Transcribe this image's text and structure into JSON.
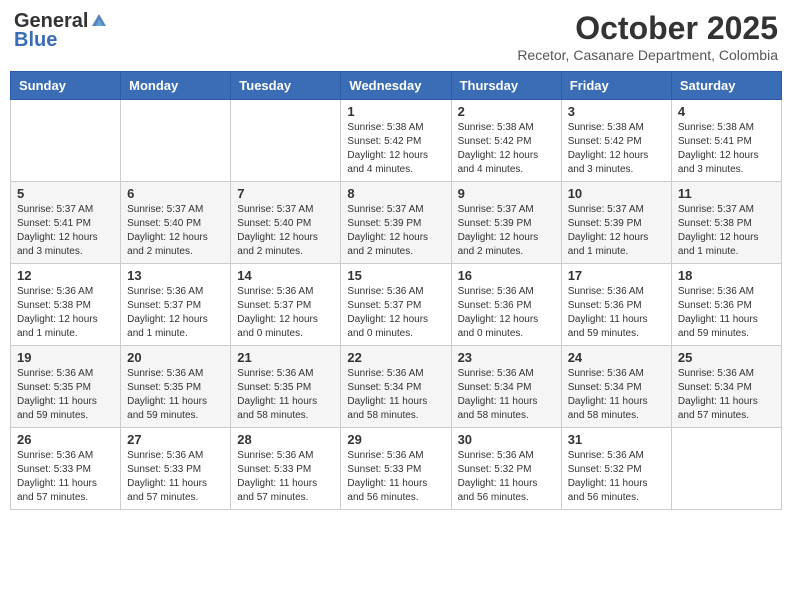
{
  "header": {
    "logo_general": "General",
    "logo_blue": "Blue",
    "month": "October 2025",
    "location": "Recetor, Casanare Department, Colombia"
  },
  "weekdays": [
    "Sunday",
    "Monday",
    "Tuesday",
    "Wednesday",
    "Thursday",
    "Friday",
    "Saturday"
  ],
  "weeks": [
    [
      {
        "day": "",
        "info": ""
      },
      {
        "day": "",
        "info": ""
      },
      {
        "day": "",
        "info": ""
      },
      {
        "day": "1",
        "info": "Sunrise: 5:38 AM\nSunset: 5:42 PM\nDaylight: 12 hours\nand 4 minutes."
      },
      {
        "day": "2",
        "info": "Sunrise: 5:38 AM\nSunset: 5:42 PM\nDaylight: 12 hours\nand 4 minutes."
      },
      {
        "day": "3",
        "info": "Sunrise: 5:38 AM\nSunset: 5:42 PM\nDaylight: 12 hours\nand 3 minutes."
      },
      {
        "day": "4",
        "info": "Sunrise: 5:38 AM\nSunset: 5:41 PM\nDaylight: 12 hours\nand 3 minutes."
      }
    ],
    [
      {
        "day": "5",
        "info": "Sunrise: 5:37 AM\nSunset: 5:41 PM\nDaylight: 12 hours\nand 3 minutes."
      },
      {
        "day": "6",
        "info": "Sunrise: 5:37 AM\nSunset: 5:40 PM\nDaylight: 12 hours\nand 2 minutes."
      },
      {
        "day": "7",
        "info": "Sunrise: 5:37 AM\nSunset: 5:40 PM\nDaylight: 12 hours\nand 2 minutes."
      },
      {
        "day": "8",
        "info": "Sunrise: 5:37 AM\nSunset: 5:39 PM\nDaylight: 12 hours\nand 2 minutes."
      },
      {
        "day": "9",
        "info": "Sunrise: 5:37 AM\nSunset: 5:39 PM\nDaylight: 12 hours\nand 2 minutes."
      },
      {
        "day": "10",
        "info": "Sunrise: 5:37 AM\nSunset: 5:39 PM\nDaylight: 12 hours\nand 1 minute."
      },
      {
        "day": "11",
        "info": "Sunrise: 5:37 AM\nSunset: 5:38 PM\nDaylight: 12 hours\nand 1 minute."
      }
    ],
    [
      {
        "day": "12",
        "info": "Sunrise: 5:36 AM\nSunset: 5:38 PM\nDaylight: 12 hours\nand 1 minute."
      },
      {
        "day": "13",
        "info": "Sunrise: 5:36 AM\nSunset: 5:37 PM\nDaylight: 12 hours\nand 1 minute."
      },
      {
        "day": "14",
        "info": "Sunrise: 5:36 AM\nSunset: 5:37 PM\nDaylight: 12 hours\nand 0 minutes."
      },
      {
        "day": "15",
        "info": "Sunrise: 5:36 AM\nSunset: 5:37 PM\nDaylight: 12 hours\nand 0 minutes."
      },
      {
        "day": "16",
        "info": "Sunrise: 5:36 AM\nSunset: 5:36 PM\nDaylight: 12 hours\nand 0 minutes."
      },
      {
        "day": "17",
        "info": "Sunrise: 5:36 AM\nSunset: 5:36 PM\nDaylight: 11 hours\nand 59 minutes."
      },
      {
        "day": "18",
        "info": "Sunrise: 5:36 AM\nSunset: 5:36 PM\nDaylight: 11 hours\nand 59 minutes."
      }
    ],
    [
      {
        "day": "19",
        "info": "Sunrise: 5:36 AM\nSunset: 5:35 PM\nDaylight: 11 hours\nand 59 minutes."
      },
      {
        "day": "20",
        "info": "Sunrise: 5:36 AM\nSunset: 5:35 PM\nDaylight: 11 hours\nand 59 minutes."
      },
      {
        "day": "21",
        "info": "Sunrise: 5:36 AM\nSunset: 5:35 PM\nDaylight: 11 hours\nand 58 minutes."
      },
      {
        "day": "22",
        "info": "Sunrise: 5:36 AM\nSunset: 5:34 PM\nDaylight: 11 hours\nand 58 minutes."
      },
      {
        "day": "23",
        "info": "Sunrise: 5:36 AM\nSunset: 5:34 PM\nDaylight: 11 hours\nand 58 minutes."
      },
      {
        "day": "24",
        "info": "Sunrise: 5:36 AM\nSunset: 5:34 PM\nDaylight: 11 hours\nand 58 minutes."
      },
      {
        "day": "25",
        "info": "Sunrise: 5:36 AM\nSunset: 5:34 PM\nDaylight: 11 hours\nand 57 minutes."
      }
    ],
    [
      {
        "day": "26",
        "info": "Sunrise: 5:36 AM\nSunset: 5:33 PM\nDaylight: 11 hours\nand 57 minutes."
      },
      {
        "day": "27",
        "info": "Sunrise: 5:36 AM\nSunset: 5:33 PM\nDaylight: 11 hours\nand 57 minutes."
      },
      {
        "day": "28",
        "info": "Sunrise: 5:36 AM\nSunset: 5:33 PM\nDaylight: 11 hours\nand 57 minutes."
      },
      {
        "day": "29",
        "info": "Sunrise: 5:36 AM\nSunset: 5:33 PM\nDaylight: 11 hours\nand 56 minutes."
      },
      {
        "day": "30",
        "info": "Sunrise: 5:36 AM\nSunset: 5:32 PM\nDaylight: 11 hours\nand 56 minutes."
      },
      {
        "day": "31",
        "info": "Sunrise: 5:36 AM\nSunset: 5:32 PM\nDaylight: 11 hours\nand 56 minutes."
      },
      {
        "day": "",
        "info": ""
      }
    ]
  ]
}
